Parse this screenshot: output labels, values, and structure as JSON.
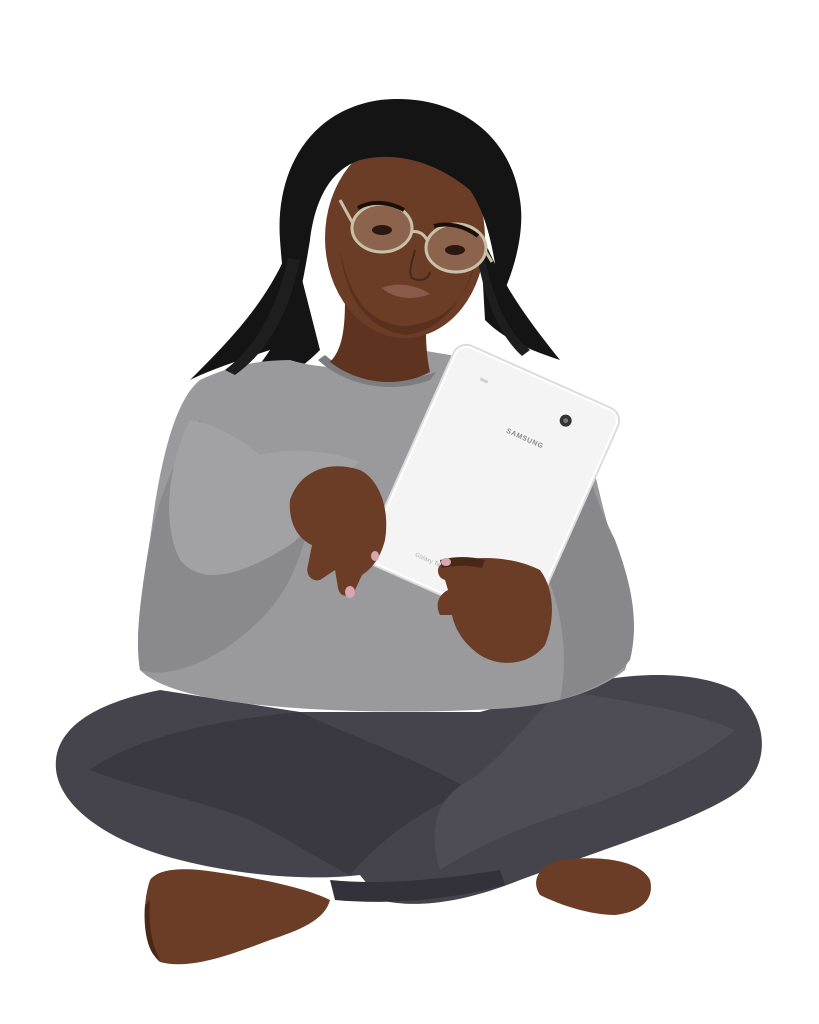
{
  "scene": {
    "background": "#ffffff",
    "subject": "person-with-tablet",
    "tablet": {
      "brand_label": "SAMSUNG",
      "model_label": "Galaxy Tab E",
      "color": "#f4f4f4"
    },
    "colors": {
      "skin": "#6b3d26",
      "skin_shadow": "#4a2818",
      "hair": "#141414",
      "sweater": "#9a9a9c",
      "sweater_shadow": "#7d7d80",
      "jeans": "#45434b",
      "jeans_shadow": "#333139",
      "glasses_frame": "#c9c0a8",
      "lips": "#8a5a4a"
    }
  }
}
